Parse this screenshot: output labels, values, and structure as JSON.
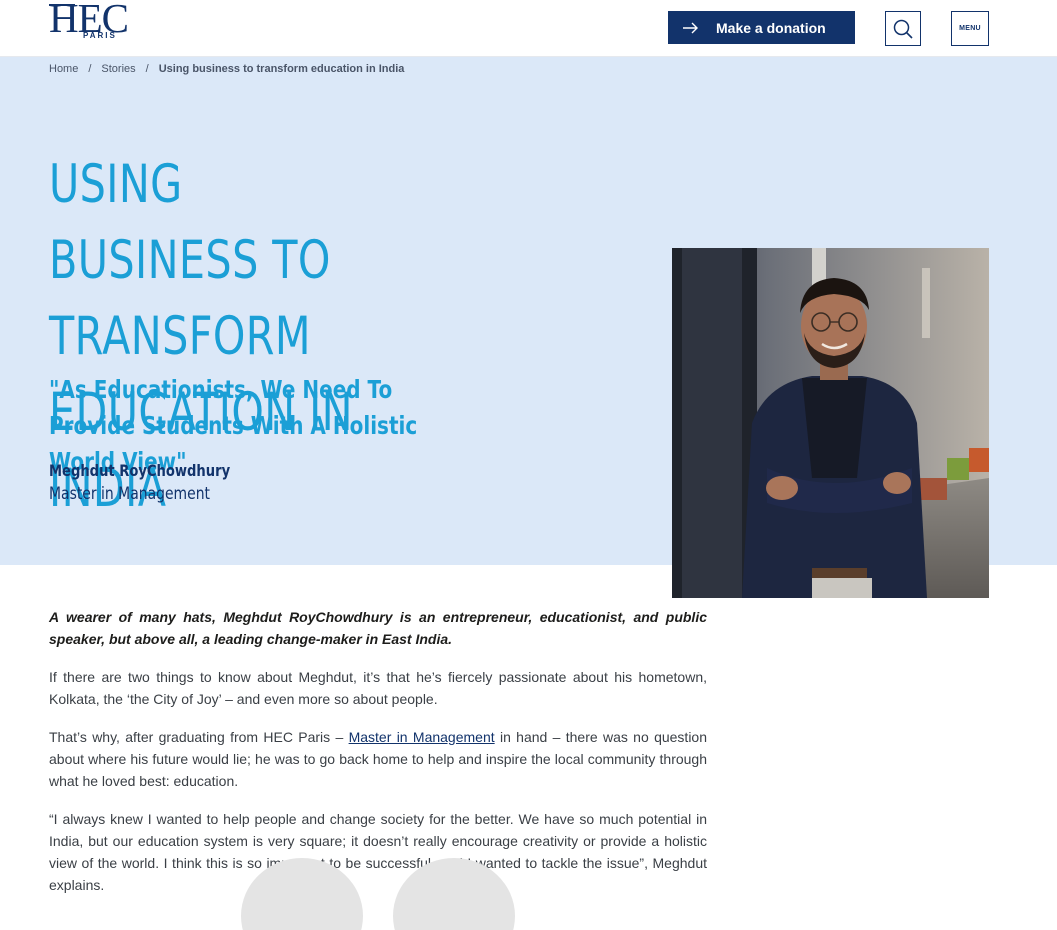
{
  "header": {
    "logo_main": "HEC",
    "logo_sub": "PARIS",
    "donate_label": "Make a donation",
    "menu_label": "MENU",
    "brand_color": "#12336b"
  },
  "breadcrumb": {
    "items": [
      "Home",
      "Stories"
    ],
    "current": "Using business to transform education in India"
  },
  "hero": {
    "title": "Using business to transform education in India",
    "quote": "\"As Educationists, We Need To Provide Students With A Holistic World View\"",
    "person_name": "Meghdut RoyChowdhury",
    "program": "Master in Management",
    "background_color": "#dbe8f8",
    "accent_color": "#1b9fd6"
  },
  "article": {
    "lead": "A wearer of many hats, Meghdut RoyChowdhury is an entrepreneur, educationist, and public speaker, but above all, a leading change-maker in East India.",
    "p1": "If there are two things to know about Meghdut, it’s that he’s fiercely passionate about his hometown, Kolkata, the ‘the City of Joy’ – and even more so about people.",
    "p2_before": "That’s why, after graduating from HEC Paris – ",
    "p2_link": "Master in Management",
    "p2_after": " in hand – there was no question about where his future would lie; he was to go back home to help and inspire the local community through what he loved best: education.",
    "p3": "“I always knew I wanted to help people and change society for the better. We have so much potential in India, but our education system is very square; it doesn’t really encourage creativity or provide a holistic view of the world. I think this is so important to be successful, and I wanted to tackle the issue”, Meghdut explains."
  },
  "icons": {
    "donate": "arrow-right-icon",
    "search": "search-icon",
    "quote": "quote-marks-icon"
  }
}
